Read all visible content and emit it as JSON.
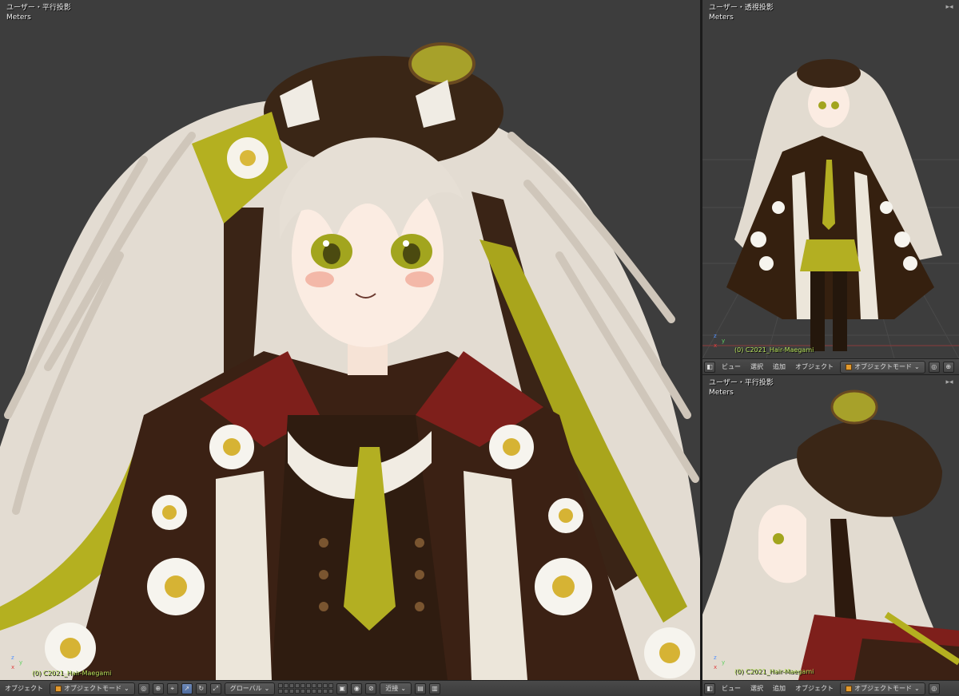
{
  "main_view": {
    "title": "ユーザー・平行投影",
    "unit": "Meters",
    "object_label": "(0) C2021_Hair-Maegami"
  },
  "right_top_view": {
    "title": "ユーザー・透視投影",
    "unit": "Meters",
    "object_label": "(0) C2021_Hair-Maegami"
  },
  "right_bottom_view": {
    "title": "ユーザー・平行投影",
    "unit": "Meters",
    "object_label": "(0) C2021_Hair-Maegami"
  },
  "toolbar_main": {
    "object_menu": "オブジェクト",
    "mode": "オブジェクトモード",
    "orientation": "グローバル",
    "snap": "近接"
  },
  "toolbar_side": {
    "view_menu": "ビュー",
    "select_menu": "選択",
    "add_menu": "追加",
    "object_menu": "オブジェクト",
    "mode": "オブジェクトモード"
  },
  "icons": [
    "view-cube-icon",
    "shading-icon",
    "pivot-icon",
    "manipulator-icon",
    "translate-icon",
    "rotate-icon",
    "scale-icon",
    "layers-icon",
    "snap-icon",
    "render-icon"
  ]
}
